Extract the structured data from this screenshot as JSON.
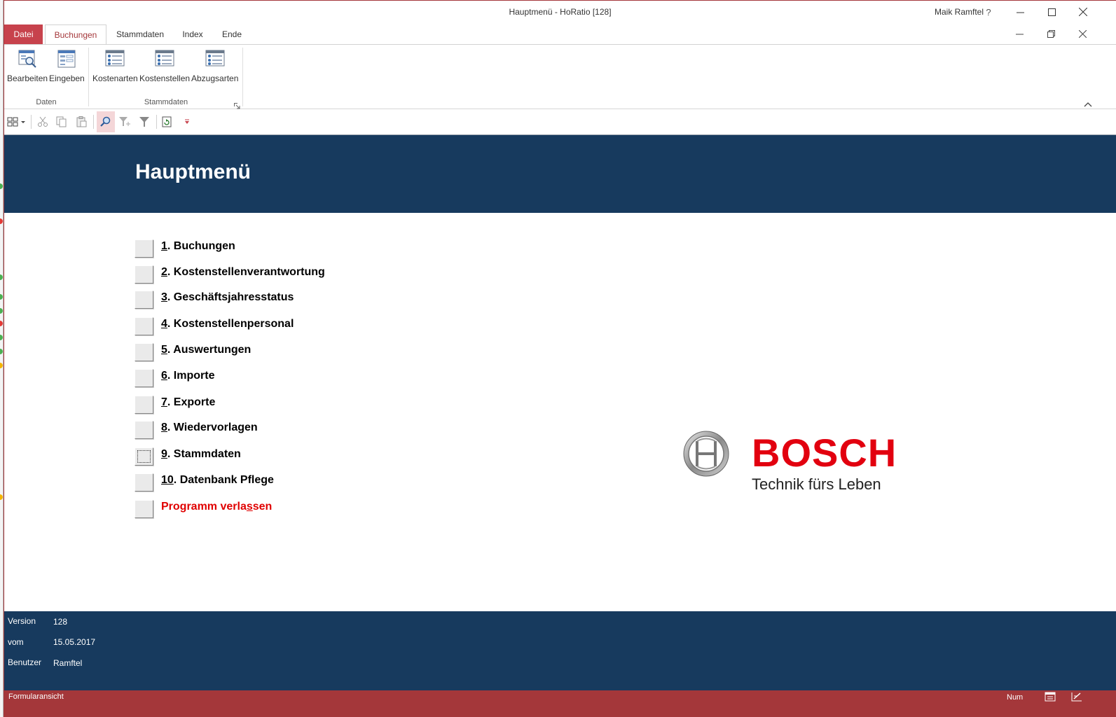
{
  "window": {
    "title": "Hauptmenü  -  HoRatio [128]",
    "user": "Maik Ramftel",
    "help_label": "?"
  },
  "tabs": [
    {
      "label": "Datei"
    },
    {
      "label": "Buchungen"
    },
    {
      "label": "Stammdaten"
    },
    {
      "label": "Index"
    },
    {
      "label": "Ende"
    }
  ],
  "ribbon": {
    "groups": [
      {
        "label": "Daten",
        "buttons": [
          {
            "label": "Bearbeiten",
            "icon": "form-search-icon"
          },
          {
            "label": "Eingeben",
            "icon": "form-list-icon"
          }
        ]
      },
      {
        "label": "Stammdaten",
        "buttons": [
          {
            "label": "Kostenarten",
            "icon": "contact-list-icon"
          },
          {
            "label": "Kostenstellen",
            "icon": "contact-list-icon"
          },
          {
            "label": "Abzugsarten",
            "icon": "contact-list-icon"
          }
        ]
      }
    ]
  },
  "form": {
    "title": "Hauptmenü",
    "menu": [
      {
        "key": "1",
        "text": ". Buchungen"
      },
      {
        "key": "2",
        "text": ". Kostenstellenverantwortung"
      },
      {
        "key": "3",
        "text": ". Geschäftsjahresstatus"
      },
      {
        "key": "4",
        "text": ". Kostenstellenpersonal"
      },
      {
        "key": "5",
        "text": ". Auswertungen"
      },
      {
        "key": "6",
        "text": ". Importe"
      },
      {
        "key": "7",
        "text": ". Exporte"
      },
      {
        "key": "8",
        "text": ". Wiedervorlagen"
      },
      {
        "key": "9",
        "text": ". Stammdaten"
      },
      {
        "key": "10",
        "text": ". Datenbank Pflege"
      }
    ],
    "exit": {
      "before": "Programm verla",
      "key": "s",
      "after": "sen"
    },
    "logo": {
      "word": "BOSCH",
      "slogan": "Technik fürs Leben",
      "color": "#e2000f"
    },
    "info": [
      {
        "label": "Version",
        "value": "128"
      },
      {
        "label": "vom",
        "value": "15.05.2017"
      },
      {
        "label": "Benutzer",
        "value": "Ramftel"
      }
    ]
  },
  "status": {
    "text": "Formularansicht",
    "num": "Num"
  },
  "colors": {
    "accent": "#a4373a",
    "file_tab": "#c7424c",
    "header_blue": "#173a5e"
  }
}
